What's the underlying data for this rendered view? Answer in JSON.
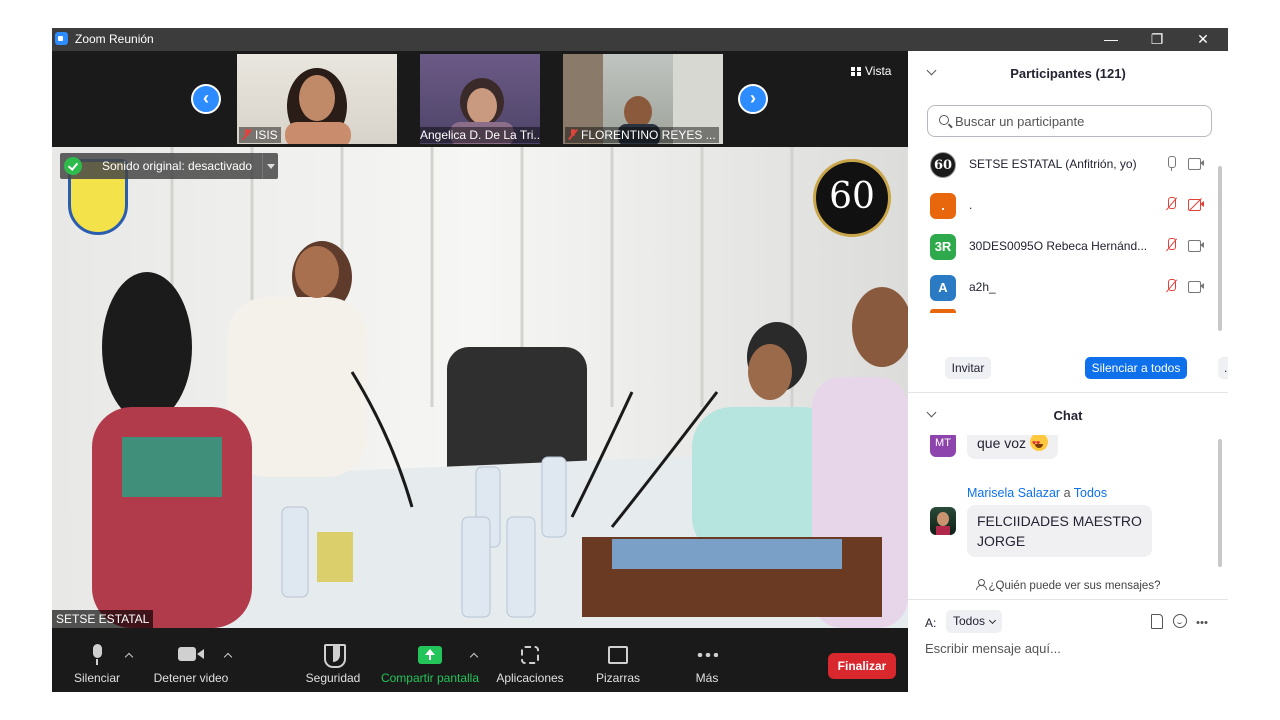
{
  "window": {
    "title": "Zoom Reunión",
    "controls": {
      "minimize": "—",
      "restore": "❐",
      "close": "✕"
    }
  },
  "colors": {
    "accent": "#0e71eb",
    "end_button": "#d9272e",
    "share_green": "#23c45a",
    "muted_red": "#e0433b"
  },
  "thumbnails": [
    {
      "name": "ISIS",
      "muted": true
    },
    {
      "name": "Angelica D. De La Tri...",
      "muted": true
    },
    {
      "name": "FLORENTINO REYES ...",
      "muted": true
    }
  ],
  "view_button": "Vista",
  "sound_banner": "Sonido original: desactivado",
  "active_speaker": "SETSE ESTATAL",
  "video_logo_text": "60",
  "toolbar": {
    "mute": "Silenciar",
    "video": "Detener video",
    "security": "Seguridad",
    "share": "Compartir pantalla",
    "apps": "Aplicaciones",
    "whiteboards": "Pizarras",
    "more": "Más",
    "end": "Finalizar"
  },
  "participants": {
    "title": "Participantes (121)",
    "search_placeholder": "Buscar un participante",
    "list": [
      {
        "avatar": "60",
        "avatar_color": "#1a1a1a",
        "name": "SETSE ESTATAL (Anfitrión, yo)",
        "mic_muted": false,
        "cam_off": false
      },
      {
        "avatar": ".",
        "avatar_color": "#e8660c",
        "name": ".",
        "mic_muted": true,
        "cam_off": true
      },
      {
        "avatar": "3R",
        "avatar_color": "#2eaa4c",
        "name": "30DES0095O  Rebeca Hernánd...",
        "mic_muted": true,
        "cam_off": false
      },
      {
        "avatar": "A",
        "avatar_color": "#2a7bc4",
        "name": "a2h_",
        "mic_muted": true,
        "cam_off": false
      }
    ],
    "invite": "Invitar",
    "mute_all": "Silenciar a todos",
    "more": "..."
  },
  "chat": {
    "title": "Chat",
    "messages": [
      {
        "avatar": "MT",
        "avatar_color": "#8e44ad",
        "text": "que voz",
        "has_emoji": true
      },
      {
        "sender": "Marisela Salazar",
        "to_word": "a",
        "recipient": "Todos",
        "lines": [
          "FELCIIDADES MAESTRO",
          "JORGE"
        ]
      }
    ],
    "who_can_see": "¿Quién puede ver sus mensajes?",
    "to_label": "A:",
    "to_value": "Todos",
    "input_placeholder": "Escribir mensaje aquí..."
  }
}
